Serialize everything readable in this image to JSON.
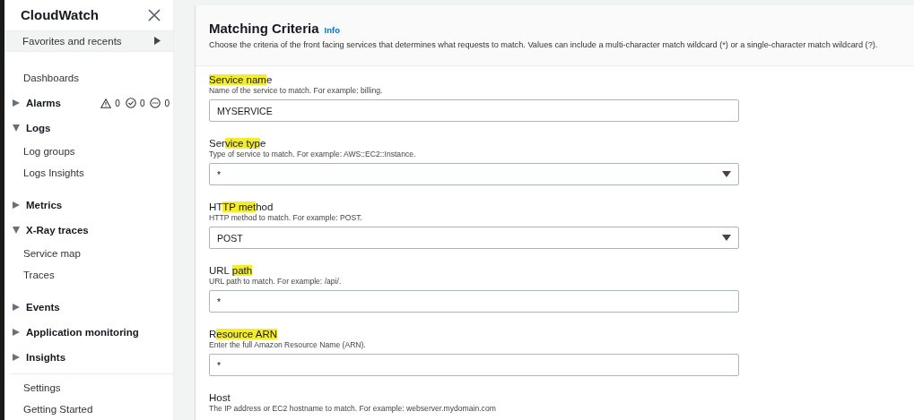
{
  "sidebar": {
    "title": "CloudWatch",
    "favorites": "Favorites and recents",
    "items": [
      {
        "kind": "link",
        "label": "Dashboards"
      },
      {
        "kind": "section",
        "label": "Alarms",
        "expanded": false,
        "alarm_counts": [
          "0",
          "0",
          "0"
        ]
      },
      {
        "kind": "section",
        "label": "Logs",
        "expanded": true,
        "children": [
          {
            "label": "Log groups"
          },
          {
            "label": "Logs Insights"
          }
        ]
      },
      {
        "kind": "section",
        "label": "Metrics",
        "expanded": false
      },
      {
        "kind": "section",
        "label": "X-Ray traces",
        "expanded": true,
        "children": [
          {
            "label": "Service map"
          },
          {
            "label": "Traces"
          }
        ]
      },
      {
        "kind": "section",
        "label": "Events",
        "expanded": false
      },
      {
        "kind": "section",
        "label": "Application monitoring",
        "expanded": false
      },
      {
        "kind": "section",
        "label": "Insights",
        "expanded": false
      },
      {
        "kind": "divider"
      },
      {
        "kind": "link",
        "label": "Settings"
      },
      {
        "kind": "link",
        "label": "Getting Started"
      }
    ]
  },
  "panel": {
    "title": "Matching Criteria",
    "info": "Info",
    "description": "Choose the criteria of the front facing services that determines what requests to match. Values can include a multi-character match wildcard (*) or a single-character match wildcard (?).",
    "fields": [
      {
        "kind": "text",
        "label": [
          {
            "text": "Service nam",
            "highlighted": true
          },
          {
            "text": "e",
            "highlighted": false
          }
        ],
        "hint": "Name of the service to match. For example: billing.",
        "value": "MYSERVICE"
      },
      {
        "kind": "select",
        "label": [
          {
            "text": "Ser",
            "highlighted": false
          },
          {
            "text": "vice typ",
            "highlighted": true
          },
          {
            "text": "e",
            "highlighted": false
          }
        ],
        "hint": "Type of service to match. For example: AWS::EC2::Instance.",
        "value": "*"
      },
      {
        "kind": "select",
        "label": [
          {
            "text": "HT",
            "highlighted": false
          },
          {
            "text": "TP met",
            "highlighted": true
          },
          {
            "text": "hod",
            "highlighted": false
          }
        ],
        "hint": "HTTP method to match. For example: POST.",
        "value": "POST"
      },
      {
        "kind": "text",
        "label": [
          {
            "text": "URL ",
            "highlighted": false
          },
          {
            "text": "path",
            "highlighted": true
          }
        ],
        "hint": "URL path to match. For example: /api/.",
        "value": "*"
      },
      {
        "kind": "text",
        "label": [
          {
            "text": "R",
            "highlighted": false
          },
          {
            "text": "esource ARN",
            "highlighted": true
          }
        ],
        "hint": "Enter the full Amazon Resource Name (ARN).",
        "value": "*"
      },
      {
        "kind": "none",
        "label": [
          {
            "text": "Host",
            "highlighted": false
          }
        ],
        "hint": "The IP address or EC2 hostname to match. For example: webserver.mydomain.com"
      }
    ]
  }
}
